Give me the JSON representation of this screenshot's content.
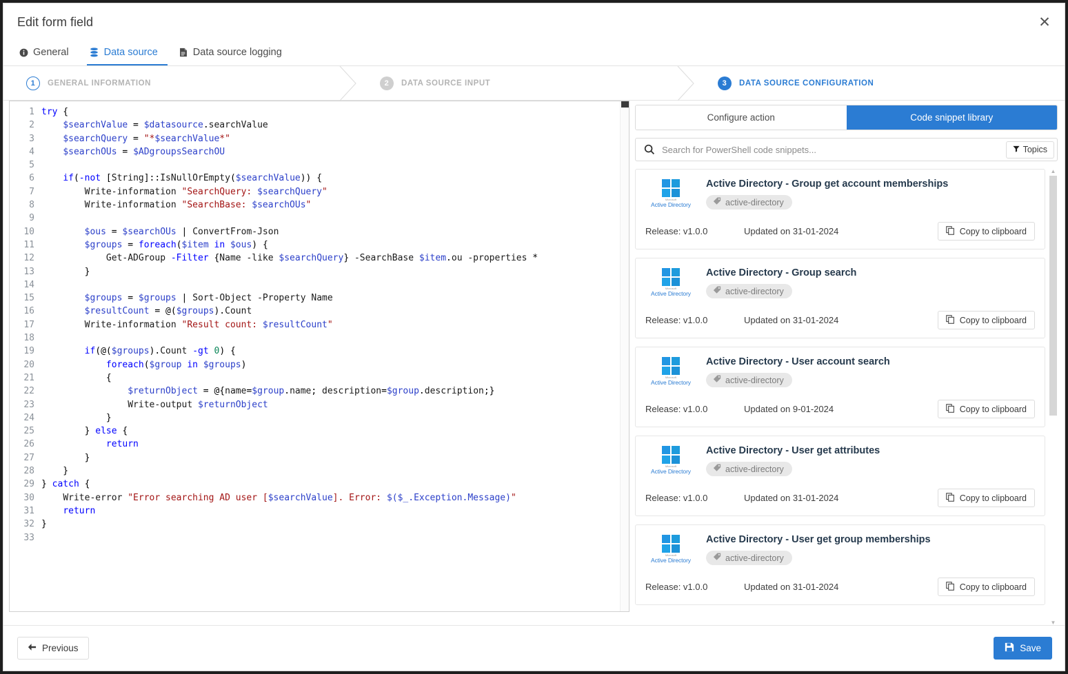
{
  "window": {
    "title": "Edit form field",
    "close_label": "✕"
  },
  "tabs": [
    {
      "label": "General",
      "icon": "info-icon",
      "active": false
    },
    {
      "label": "Data source",
      "icon": "database-icon",
      "active": true
    },
    {
      "label": "Data source logging",
      "icon": "document-icon",
      "active": false
    }
  ],
  "stepper": [
    {
      "num": "1",
      "label": "GENERAL INFORMATION",
      "state": "done"
    },
    {
      "num": "2",
      "label": "DATA SOURCE INPUT",
      "state": "idle"
    },
    {
      "num": "3",
      "label": "DATA SOURCE CONFIGURATION",
      "state": "cur"
    }
  ],
  "editor": {
    "total_lines": 33,
    "lines": [
      "try {",
      "    $searchValue = $datasource.searchValue",
      "    $searchQuery = \"*$searchValue*\"",
      "    $searchOUs = $ADgroupsSearchOU",
      "",
      "    if(-not [String]::IsNullOrEmpty($searchValue)) {",
      "        Write-information \"SearchQuery: $searchQuery\"",
      "        Write-information \"SearchBase: $searchOUs\"",
      "",
      "        $ous = $searchOUs | ConvertFrom-Json",
      "        $groups = foreach($item in $ous) {",
      "            Get-ADGroup -Filter {Name -like $searchQuery} -SearchBase $item.ou -properties *",
      "        }",
      "",
      "        $groups = $groups | Sort-Object -Property Name",
      "        $resultCount = @($groups).Count",
      "        Write-information \"Result count: $resultCount\"",
      "",
      "        if(@($groups).Count -gt 0) {",
      "            foreach($group in $groups)",
      "            {",
      "                $returnObject = @{name=$group.name; description=$group.description;}",
      "                Write-output $returnObject",
      "            }",
      "        } else {",
      "            return",
      "        }",
      "    }",
      "} catch {",
      "    Write-error \"Error searching AD user [$searchValue]. Error: $($_.Exception.Message)\"",
      "    return",
      "}",
      ""
    ]
  },
  "panel": {
    "segments": [
      {
        "label": "Configure action",
        "active": false
      },
      {
        "label": "Code snippet library",
        "active": true
      }
    ],
    "search": {
      "placeholder": "Search for PowerShell code snippets...",
      "value": "",
      "icon": "search-icon"
    },
    "topics_button": {
      "label": "Topics",
      "icon": "filter-icon"
    },
    "copy_label": "Copy to clipboard",
    "snippets": [
      {
        "title": "Active Directory - Group get account memberships",
        "tag": "active-directory",
        "logo_label": "Active Directory",
        "logo_sub": "Microsoft",
        "release": "Release: v1.0.0",
        "updated": "Updated on 31-01-2024"
      },
      {
        "title": "Active Directory - Group search",
        "tag": "active-directory",
        "logo_label": "Active Directory",
        "logo_sub": "Microsoft",
        "release": "Release: v1.0.0",
        "updated": "Updated on 31-01-2024"
      },
      {
        "title": "Active Directory - User account search",
        "tag": "active-directory",
        "logo_label": "Active Directory",
        "logo_sub": "Microsoft",
        "release": "Release: v1.0.0",
        "updated": "Updated on 9-01-2024"
      },
      {
        "title": "Active Directory - User get attributes",
        "tag": "active-directory",
        "logo_label": "Active Directory",
        "logo_sub": "Microsoft",
        "release": "Release: v1.0.0",
        "updated": "Updated on 31-01-2024"
      },
      {
        "title": "Active Directory - User get group memberships",
        "tag": "active-directory",
        "logo_label": "Active Directory",
        "logo_sub": "Microsoft",
        "release": "Release: v1.0.0",
        "updated": "Updated on 31-01-2024"
      }
    ]
  },
  "footer": {
    "previous_label": "Previous",
    "save_label": "Save"
  },
  "colors": {
    "accent": "#2b7cd3",
    "tag_bg": "#e8e8e8",
    "string": "#a31515",
    "keyword": "#0000ff",
    "variable": "#2b3fc9"
  }
}
